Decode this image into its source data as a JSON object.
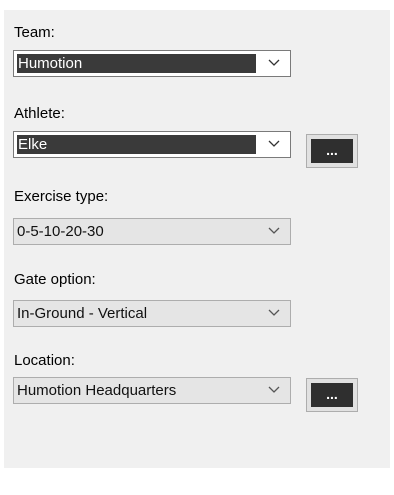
{
  "team": {
    "label": "Team:",
    "value": "Humotion",
    "icon": "chevron-down-icon"
  },
  "athlete": {
    "label": "Athlete:",
    "value": "Elke",
    "icon": "chevron-down-icon",
    "browse_label": "..."
  },
  "exercise_type": {
    "label": "Exercise type:",
    "value": "0-5-10-20-30",
    "icon": "chevron-down-icon"
  },
  "gate_option": {
    "label": "Gate option:",
    "value": "In-Ground - Vertical",
    "icon": "chevron-down-icon"
  },
  "location": {
    "label": "Location:",
    "value": "Humotion Headquarters",
    "icon": "chevron-down-icon",
    "browse_label": "..."
  },
  "colors": {
    "panel_bg": "#f0f0f0",
    "selection_bg": "#3a3a3a",
    "disabled_bg": "#e5e5e5"
  }
}
